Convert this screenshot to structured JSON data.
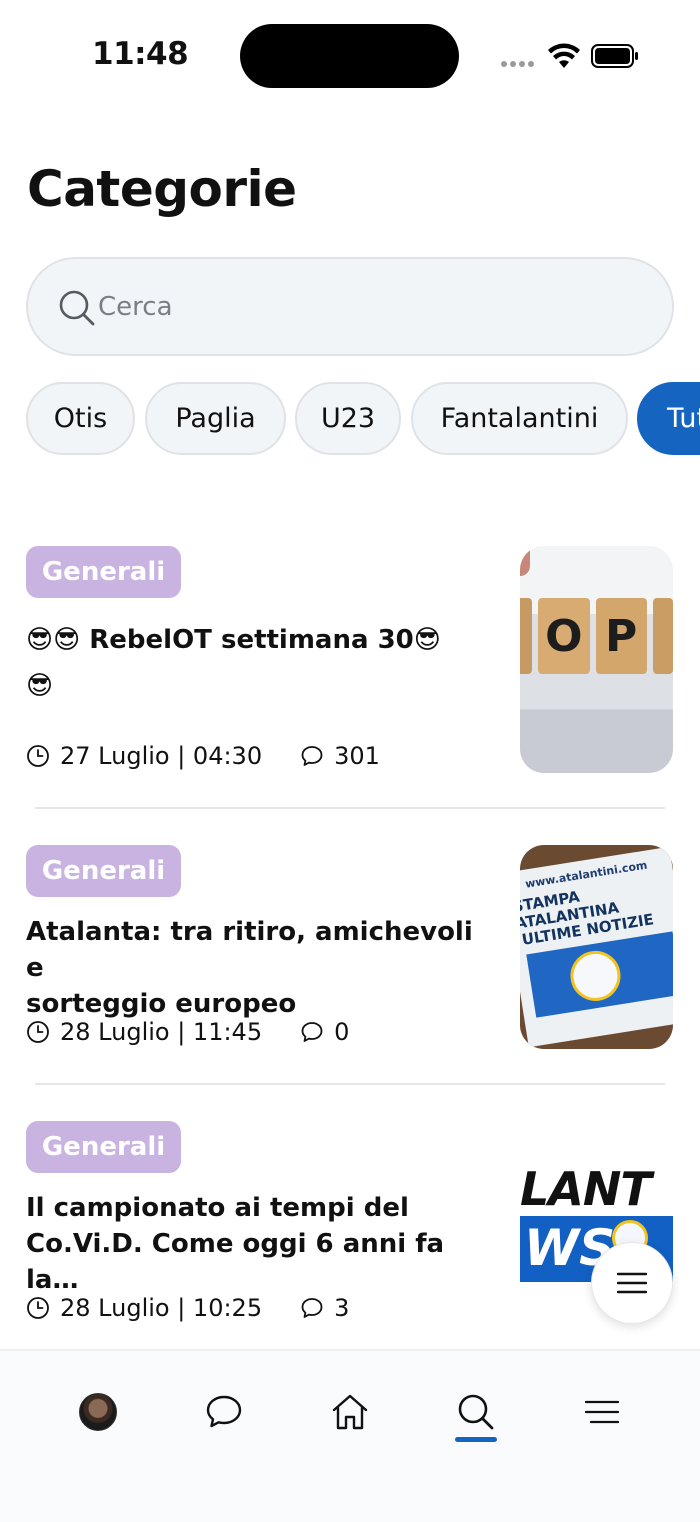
{
  "status_bar": {
    "time": "11:48"
  },
  "page": {
    "title": "Categorie"
  },
  "search": {
    "placeholder": "Cerca"
  },
  "chips": [
    "Otis",
    "Paglia",
    "U23",
    "Fantalantini",
    "Tutti"
  ],
  "articles": [
    {
      "category": "Generali",
      "title_line1": "😎😎 RebelOT settimana 30😎",
      "title_line2": "😎",
      "date": "27 Luglio | 04:30",
      "comments": "301",
      "thumb_text": "OP"
    },
    {
      "category": "Generali",
      "title_line1": "Atalanta: tra ritiro, amichevoli e",
      "title_line2": "sorteggio europeo",
      "date": "28 Luglio | 11:45",
      "comments": "0",
      "thumb_text_top": "www.atalantini.com",
      "thumb_text_main1": "STAMPA ATALANTINA",
      "thumb_text_main2": "ULTIME NOTIZIE"
    },
    {
      "category": "Generali",
      "title_line1": "Il campionato ai tempi del",
      "title_line2": "Co.Vi.D. Come oggi 6 anni fa la…",
      "date": "28 Luglio | 10:25",
      "comments": "3",
      "thumb_text_top": "LANT",
      "thumb_text_bottom": "WS"
    }
  ],
  "nav": {
    "items": [
      "profile",
      "chat",
      "home",
      "search",
      "menu"
    ],
    "active": "search"
  },
  "colors": {
    "accent": "#1565c0",
    "badge": "#c9b3e0"
  }
}
